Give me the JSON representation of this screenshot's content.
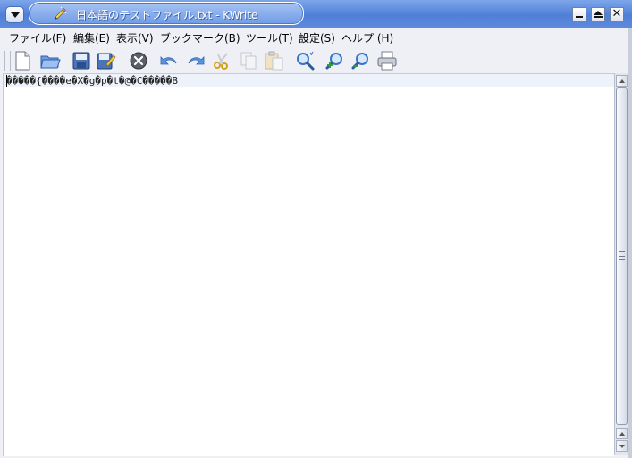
{
  "window": {
    "title": "日本語のテストファイル.txt - KWrite",
    "buttons": {
      "menu_icon": "chevron-down-icon",
      "minimize_icon": "minimize-icon",
      "maximize_icon": "maximize-icon",
      "close_icon": "close-icon",
      "close_glyph": "✕"
    }
  },
  "menubar": {
    "items": [
      {
        "label": "ファイル(F)"
      },
      {
        "label": "編集(E)"
      },
      {
        "label": "表示(V)"
      },
      {
        "label": "ブックマーク(B)"
      },
      {
        "label": "ツール(T)"
      },
      {
        "label": "設定(S)"
      },
      {
        "label": "ヘルプ (H)"
      }
    ]
  },
  "toolbar": {
    "icons": [
      "new-document-icon",
      "open-folder-icon",
      "save-icon",
      "save-as-icon",
      "close-document-icon",
      "undo-icon",
      "redo-icon",
      "cut-icon",
      "copy-icon",
      "paste-icon",
      "find-icon",
      "zoom-in-icon",
      "zoom-out-icon",
      "print-icon"
    ]
  },
  "editor": {
    "line1": "�����{����e�X�g�p�t�@�C�����B"
  },
  "colors": {
    "titlebar": "#5d8ade",
    "accent_blue": "#3f7fe0",
    "editor_bg": "#ffffff",
    "chrome_bg": "#eef0f5"
  }
}
